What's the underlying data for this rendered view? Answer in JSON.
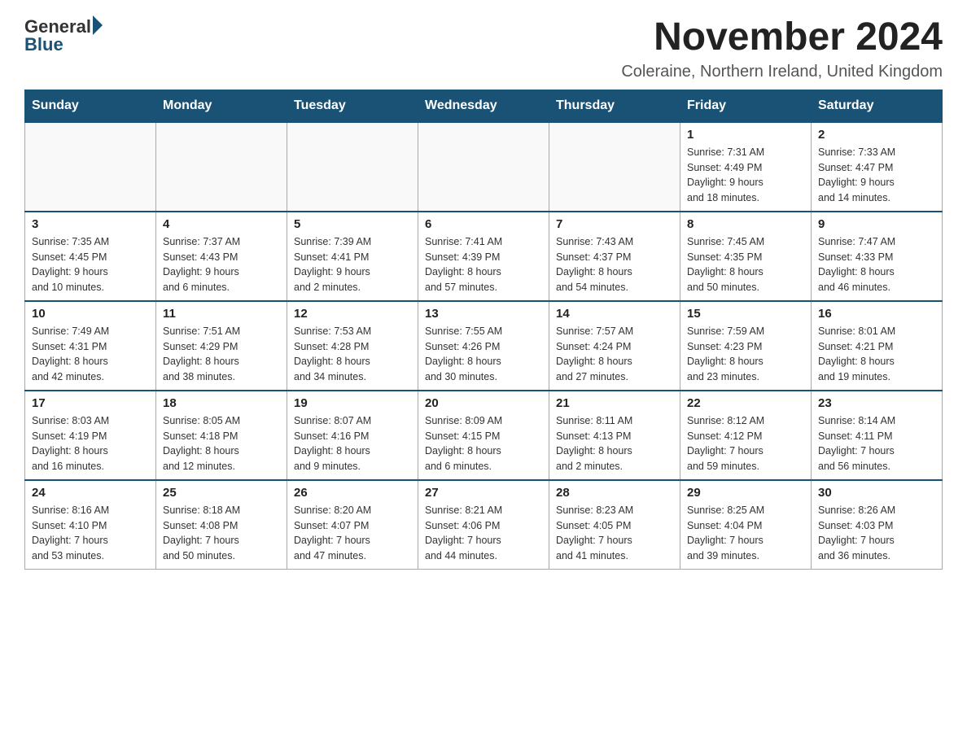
{
  "header": {
    "logo_general": "General",
    "logo_blue": "Blue",
    "title": "November 2024",
    "subtitle": "Coleraine, Northern Ireland, United Kingdom"
  },
  "days_of_week": [
    "Sunday",
    "Monday",
    "Tuesday",
    "Wednesday",
    "Thursday",
    "Friday",
    "Saturday"
  ],
  "weeks": [
    [
      {
        "day": "",
        "info": ""
      },
      {
        "day": "",
        "info": ""
      },
      {
        "day": "",
        "info": ""
      },
      {
        "day": "",
        "info": ""
      },
      {
        "day": "",
        "info": ""
      },
      {
        "day": "1",
        "info": "Sunrise: 7:31 AM\nSunset: 4:49 PM\nDaylight: 9 hours\nand 18 minutes."
      },
      {
        "day": "2",
        "info": "Sunrise: 7:33 AM\nSunset: 4:47 PM\nDaylight: 9 hours\nand 14 minutes."
      }
    ],
    [
      {
        "day": "3",
        "info": "Sunrise: 7:35 AM\nSunset: 4:45 PM\nDaylight: 9 hours\nand 10 minutes."
      },
      {
        "day": "4",
        "info": "Sunrise: 7:37 AM\nSunset: 4:43 PM\nDaylight: 9 hours\nand 6 minutes."
      },
      {
        "day": "5",
        "info": "Sunrise: 7:39 AM\nSunset: 4:41 PM\nDaylight: 9 hours\nand 2 minutes."
      },
      {
        "day": "6",
        "info": "Sunrise: 7:41 AM\nSunset: 4:39 PM\nDaylight: 8 hours\nand 57 minutes."
      },
      {
        "day": "7",
        "info": "Sunrise: 7:43 AM\nSunset: 4:37 PM\nDaylight: 8 hours\nand 54 minutes."
      },
      {
        "day": "8",
        "info": "Sunrise: 7:45 AM\nSunset: 4:35 PM\nDaylight: 8 hours\nand 50 minutes."
      },
      {
        "day": "9",
        "info": "Sunrise: 7:47 AM\nSunset: 4:33 PM\nDaylight: 8 hours\nand 46 minutes."
      }
    ],
    [
      {
        "day": "10",
        "info": "Sunrise: 7:49 AM\nSunset: 4:31 PM\nDaylight: 8 hours\nand 42 minutes."
      },
      {
        "day": "11",
        "info": "Sunrise: 7:51 AM\nSunset: 4:29 PM\nDaylight: 8 hours\nand 38 minutes."
      },
      {
        "day": "12",
        "info": "Sunrise: 7:53 AM\nSunset: 4:28 PM\nDaylight: 8 hours\nand 34 minutes."
      },
      {
        "day": "13",
        "info": "Sunrise: 7:55 AM\nSunset: 4:26 PM\nDaylight: 8 hours\nand 30 minutes."
      },
      {
        "day": "14",
        "info": "Sunrise: 7:57 AM\nSunset: 4:24 PM\nDaylight: 8 hours\nand 27 minutes."
      },
      {
        "day": "15",
        "info": "Sunrise: 7:59 AM\nSunset: 4:23 PM\nDaylight: 8 hours\nand 23 minutes."
      },
      {
        "day": "16",
        "info": "Sunrise: 8:01 AM\nSunset: 4:21 PM\nDaylight: 8 hours\nand 19 minutes."
      }
    ],
    [
      {
        "day": "17",
        "info": "Sunrise: 8:03 AM\nSunset: 4:19 PM\nDaylight: 8 hours\nand 16 minutes."
      },
      {
        "day": "18",
        "info": "Sunrise: 8:05 AM\nSunset: 4:18 PM\nDaylight: 8 hours\nand 12 minutes."
      },
      {
        "day": "19",
        "info": "Sunrise: 8:07 AM\nSunset: 4:16 PM\nDaylight: 8 hours\nand 9 minutes."
      },
      {
        "day": "20",
        "info": "Sunrise: 8:09 AM\nSunset: 4:15 PM\nDaylight: 8 hours\nand 6 minutes."
      },
      {
        "day": "21",
        "info": "Sunrise: 8:11 AM\nSunset: 4:13 PM\nDaylight: 8 hours\nand 2 minutes."
      },
      {
        "day": "22",
        "info": "Sunrise: 8:12 AM\nSunset: 4:12 PM\nDaylight: 7 hours\nand 59 minutes."
      },
      {
        "day": "23",
        "info": "Sunrise: 8:14 AM\nSunset: 4:11 PM\nDaylight: 7 hours\nand 56 minutes."
      }
    ],
    [
      {
        "day": "24",
        "info": "Sunrise: 8:16 AM\nSunset: 4:10 PM\nDaylight: 7 hours\nand 53 minutes."
      },
      {
        "day": "25",
        "info": "Sunrise: 8:18 AM\nSunset: 4:08 PM\nDaylight: 7 hours\nand 50 minutes."
      },
      {
        "day": "26",
        "info": "Sunrise: 8:20 AM\nSunset: 4:07 PM\nDaylight: 7 hours\nand 47 minutes."
      },
      {
        "day": "27",
        "info": "Sunrise: 8:21 AM\nSunset: 4:06 PM\nDaylight: 7 hours\nand 44 minutes."
      },
      {
        "day": "28",
        "info": "Sunrise: 8:23 AM\nSunset: 4:05 PM\nDaylight: 7 hours\nand 41 minutes."
      },
      {
        "day": "29",
        "info": "Sunrise: 8:25 AM\nSunset: 4:04 PM\nDaylight: 7 hours\nand 39 minutes."
      },
      {
        "day": "30",
        "info": "Sunrise: 8:26 AM\nSunset: 4:03 PM\nDaylight: 7 hours\nand 36 minutes."
      }
    ]
  ]
}
